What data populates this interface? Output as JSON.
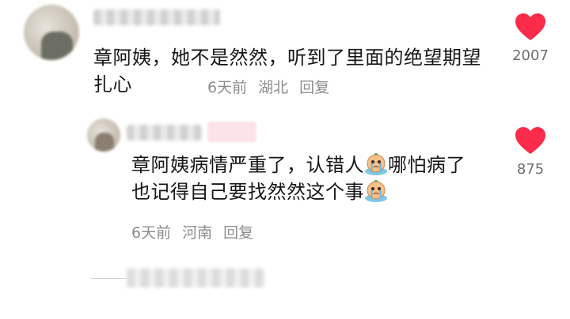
{
  "comments": [
    {
      "text": "章阿姨，她不是然然，听到了里面的绝望期望扎心",
      "time": "6天前",
      "location": "湖北",
      "reply_label": "回复",
      "like_count": "2007"
    },
    {
      "text_part1": "章阿姨病情严重了，认错人",
      "text_part2": "哪怕病了也记得自己要找然然这个事",
      "time": "6天前",
      "location": "河南",
      "reply_label": "回复",
      "like_count": "875",
      "emoji": "crying-emoji"
    }
  ],
  "colors": {
    "heart": "#fa2c4a",
    "meta": "#8c8c8c",
    "text": "#161616"
  },
  "icons": [
    "heart-icon",
    "crying-emoji"
  ]
}
